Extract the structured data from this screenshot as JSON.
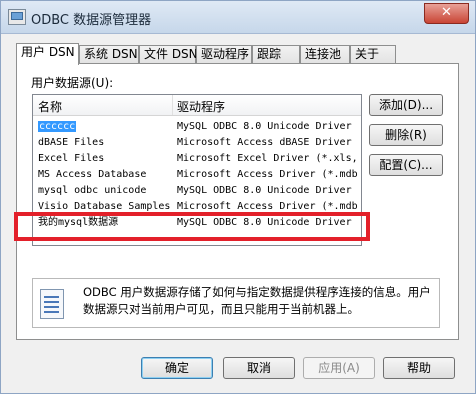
{
  "window": {
    "title": "ODBC 数据源管理器",
    "close_glyph": "✕"
  },
  "tabs": [
    {
      "label": "用户 DSN"
    },
    {
      "label": "系统 DSN"
    },
    {
      "label": "文件 DSN"
    },
    {
      "label": "驱动程序"
    },
    {
      "label": "跟踪"
    },
    {
      "label": "连接池"
    },
    {
      "label": "关于"
    }
  ],
  "section_label": "用户数据源(U):",
  "list": {
    "columns": [
      "名称",
      "驱动程序"
    ],
    "rows": [
      {
        "name": "cccccc",
        "driver": "MySQL ODBC 8.0 Unicode Driver",
        "selected": true
      },
      {
        "name": "dBASE Files",
        "driver": "Microsoft Access dBASE Driver"
      },
      {
        "name": "Excel Files",
        "driver": "Microsoft Excel Driver (*.xls,"
      },
      {
        "name": "MS Access Database",
        "driver": "Microsoft Access Driver (*.mdb"
      },
      {
        "name": "mysql odbc unicode",
        "driver": "MySQL ODBC 8.0 Unicode Driver"
      },
      {
        "name": "Visio Database Samples",
        "driver": "Microsoft Access Driver (*.mdb"
      },
      {
        "name": "我的mysql数据源",
        "driver": "MySQL ODBC 8.0 Unicode Driver"
      }
    ]
  },
  "side_buttons": {
    "add": "添加(D)...",
    "remove": "删除(R)",
    "configure": "配置(C)..."
  },
  "info_text": "ODBC 用户数据源存储了如何与指定数据提供程序连接的信息。用户数据源只对当前用户可见，而且只能用于当前机器上。",
  "footer_buttons": {
    "ok": "确定",
    "cancel": "取消",
    "apply": "应用(A)",
    "help": "帮助"
  },
  "colors": {
    "selection": "#3399ff",
    "highlight_box": "#e3202a"
  }
}
